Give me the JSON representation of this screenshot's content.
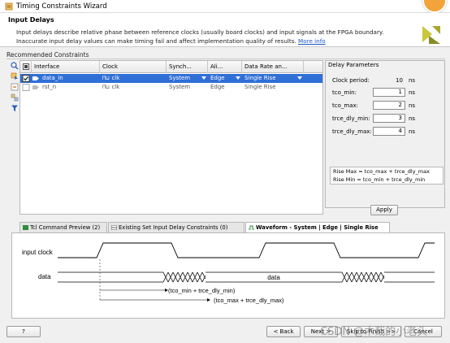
{
  "window": {
    "title": "Timing Constraints Wizard"
  },
  "header": {
    "title": "Input Delays",
    "description": "Input delays describe relative phase between reference clocks (usually board clocks) and input signals at the FPGA boundary. Inaccurate input delay values can make timing fail and affect implementation quality of results.",
    "more_info": "More info"
  },
  "recommended": {
    "label": "Recommended Constraints",
    "columns": [
      "Interface",
      "Clock",
      "Synch...",
      "Ali...",
      "Data Rate an..."
    ],
    "rows": [
      {
        "interface": "data_in",
        "clock": "clk",
        "synch": "System",
        "align": "Edge",
        "rate": "Single Rise",
        "selected": true,
        "checked": true
      },
      {
        "interface": "rst_n",
        "clock": "clk",
        "synch": "System",
        "align": "Edge",
        "rate": "Single Rise",
        "selected": false,
        "checked": false
      }
    ]
  },
  "delay_params": {
    "title": "Delay Parameters",
    "clock_period_label": "Clock period:",
    "clock_period_value": "10",
    "clock_period_unit": "ns",
    "fields": [
      {
        "label": "tco_min:",
        "value": "1",
        "unit": "ns"
      },
      {
        "label": "tco_max:",
        "value": "2",
        "unit": "ns"
      },
      {
        "label": "trce_dly_min:",
        "value": "3",
        "unit": "ns"
      },
      {
        "label": "trce_dly_max:",
        "value": "4",
        "unit": "ns"
      }
    ],
    "formula_max": "Rise Max = tco_max + trce_dly_max",
    "formula_min": "Rise Min = tco_min + trce_dly_min",
    "apply_label": "Apply"
  },
  "tabs": [
    {
      "label": "Tcl Command Preview (2)"
    },
    {
      "label": "Existing Set Input Delay Constraints (0)"
    },
    {
      "label": "Waveform - System | Edge | Single Rise"
    }
  ],
  "waveform": {
    "clock_label": "input clock",
    "data_label": "data",
    "data_text": "data",
    "annotation_min": "(tco_min + trce_dly_min)",
    "annotation_max": "(tco_max + trce_dly_max)"
  },
  "footer": {
    "help_label": "?",
    "back_label": "< Back",
    "next_label": "Next >",
    "skip_label": "Skip to Finish >>",
    "cancel_label": "Cancel",
    "watermark": "CSDN @木哉的小老头"
  },
  "colors": {
    "selection": "#2f6fd6",
    "link": "#1a55c8",
    "accent": "#f2a33a"
  }
}
